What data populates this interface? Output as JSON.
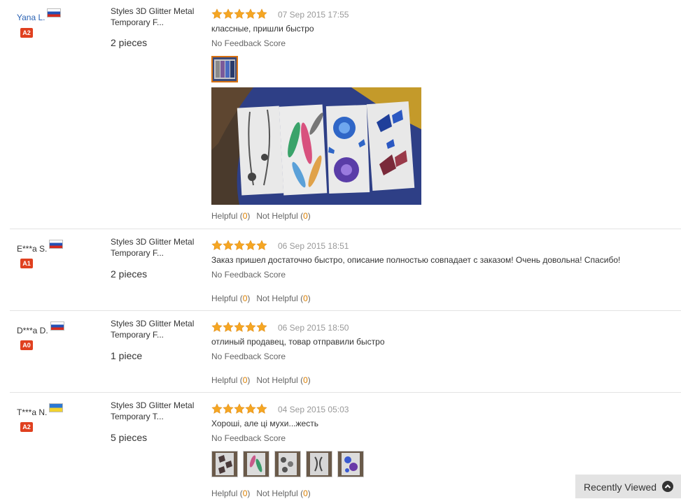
{
  "reviews": [
    {
      "user": "Yana L.",
      "flag": "flag-russia-icon",
      "level": "A2",
      "product": "Styles 3D Glitter Metal Temporary F...",
      "quantity": "2 pieces",
      "rating": 5,
      "date": "07 Sep 2015 17:55",
      "comment": "классные, пришли быстро",
      "feedback_score": "No Feedback Score",
      "helpful_label": "Helpful",
      "helpful_count": "0",
      "not_helpful_label": "Not Helpful",
      "not_helpful_count": "0"
    },
    {
      "user": "E***a S.",
      "flag": "flag-russia-icon",
      "level": "A1",
      "product": "Styles 3D Glitter Metal Temporary F...",
      "quantity": "2 pieces",
      "rating": 5,
      "date": "06 Sep 2015 18:51",
      "comment": "Заказ пришел достаточно быстро, описание полностью совпадает с заказом! Очень довольна! Спасибо!",
      "feedback_score": "No Feedback Score",
      "helpful_label": "Helpful",
      "helpful_count": "0",
      "not_helpful_label": "Not Helpful",
      "not_helpful_count": "0"
    },
    {
      "user": "D***a D.",
      "flag": "flag-russia-icon",
      "level": "A0",
      "product": "Styles 3D Glitter Metal Temporary F...",
      "quantity": "1 piece",
      "rating": 5,
      "date": "06 Sep 2015 18:50",
      "comment": "отлиный продавец, товар отправили быстро",
      "feedback_score": "No Feedback Score",
      "helpful_label": "Helpful",
      "helpful_count": "0",
      "not_helpful_label": "Not Helpful",
      "not_helpful_count": "0"
    },
    {
      "user": "T***a N.",
      "flag": "flag-ukraine-icon",
      "level": "A2",
      "product": "Styles 3D Glitter Metal Temporary T...",
      "quantity": "5 pieces",
      "rating": 5,
      "date": "04 Sep 2015 05:03",
      "comment": "Хороші, але ці мухи...жесть",
      "feedback_score": "No Feedback Score",
      "helpful_label": "Helpful",
      "helpful_count": "0",
      "not_helpful_label": "Not Helpful",
      "not_helpful_count": "0"
    }
  ],
  "recently_viewed": {
    "label": "Recently Viewed",
    "icon": "chevron-up-circle-icon"
  },
  "colors": {
    "star": "#f5a623",
    "badge": "#e0401f",
    "count": "#d97e00",
    "link": "#2a62b3"
  }
}
